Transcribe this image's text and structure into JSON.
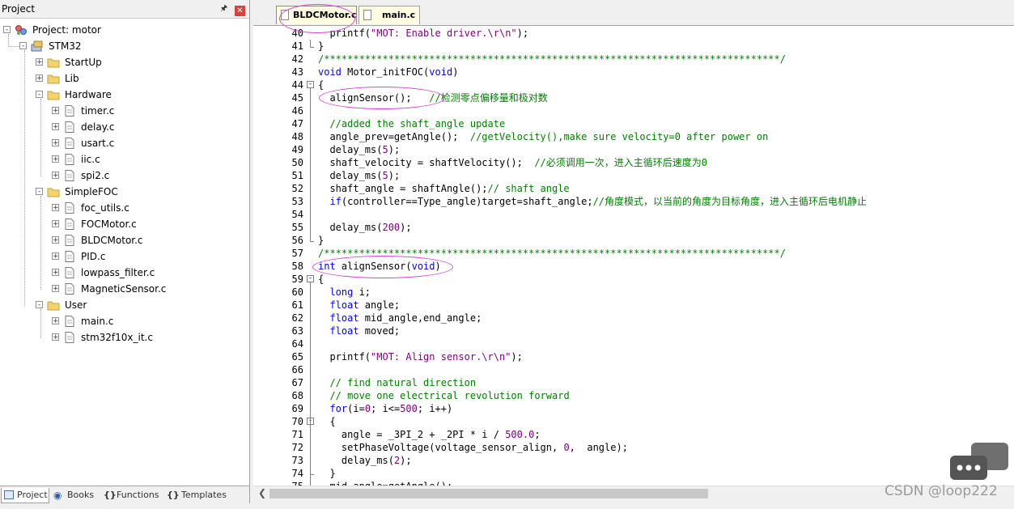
{
  "project_panel": {
    "title": "Project",
    "pin": "ㄧ",
    "close": "✕",
    "tree": [
      {
        "label": "Project: motor"
      },
      {
        "label": "STM32"
      },
      {
        "label": "StartUp"
      },
      {
        "label": "Lib"
      },
      {
        "label": "Hardware"
      },
      {
        "label": "timer.c"
      },
      {
        "label": "delay.c"
      },
      {
        "label": "usart.c"
      },
      {
        "label": "iic.c"
      },
      {
        "label": "spi2.c"
      },
      {
        "label": "SimpleFOC"
      },
      {
        "label": "foc_utils.c"
      },
      {
        "label": "FOCMotor.c"
      },
      {
        "label": "BLDCMotor.c"
      },
      {
        "label": "PID.c"
      },
      {
        "label": "lowpass_filter.c"
      },
      {
        "label": "MagneticSensor.c"
      },
      {
        "label": "User"
      },
      {
        "label": "main.c"
      },
      {
        "label": "stm32f10x_it.c"
      }
    ],
    "bottom_tabs": [
      "Project",
      "Books",
      "Functions",
      "Templates"
    ]
  },
  "editor": {
    "tabs": [
      "BLDCMotor.c",
      "main.c"
    ],
    "active_tab": "BLDCMotor.c",
    "lines": [
      {
        "n": "40",
        "code": "  printf(\"MOT: Enable driver.\\r\\n\");"
      },
      {
        "n": "41",
        "code": "}"
      },
      {
        "n": "42",
        "code": "/******************************************************************************/"
      },
      {
        "n": "43",
        "code": "void Motor_initFOC(void)"
      },
      {
        "n": "44",
        "code": "{"
      },
      {
        "n": "45",
        "code": "  alignSensor();   //检测零点偏移量和极对数"
      },
      {
        "n": "46",
        "code": ""
      },
      {
        "n": "47",
        "code": "  //added the shaft_angle update"
      },
      {
        "n": "48",
        "code": "  angle_prev=getAngle();  //getVelocity(),make sure velocity=0 after power on"
      },
      {
        "n": "49",
        "code": "  delay_ms(5);"
      },
      {
        "n": "50",
        "code": "  shaft_velocity = shaftVelocity();  //必须调用一次，进入主循环后速度为0"
      },
      {
        "n": "51",
        "code": "  delay_ms(5);"
      },
      {
        "n": "52",
        "code": "  shaft_angle = shaftAngle();// shaft angle"
      },
      {
        "n": "53",
        "code": "  if(controller==Type_angle)target=shaft_angle;//角度模式，以当前的角度为目标角度，进入主循环后电机静止"
      },
      {
        "n": "54",
        "code": ""
      },
      {
        "n": "55",
        "code": "  delay_ms(200);"
      },
      {
        "n": "56",
        "code": "}"
      },
      {
        "n": "57",
        "code": "/******************************************************************************/"
      },
      {
        "n": "58",
        "code": "int alignSensor(void)"
      },
      {
        "n": "59",
        "code": "{"
      },
      {
        "n": "60",
        "code": "  long i;"
      },
      {
        "n": "61",
        "code": "  float angle;"
      },
      {
        "n": "62",
        "code": "  float mid_angle,end_angle;"
      },
      {
        "n": "63",
        "code": "  float moved;"
      },
      {
        "n": "64",
        "code": ""
      },
      {
        "n": "65",
        "code": "  printf(\"MOT: Align sensor.\\r\\n\");"
      },
      {
        "n": "66",
        "code": ""
      },
      {
        "n": "67",
        "code": "  // find natural direction"
      },
      {
        "n": "68",
        "code": "  // move one electrical revolution forward"
      },
      {
        "n": "69",
        "code": "  for(i=0; i<=500; i++)"
      },
      {
        "n": "70",
        "code": "  {"
      },
      {
        "n": "71",
        "code": "    angle = _3PI_2 + _2PI * i / 500.0;"
      },
      {
        "n": "72",
        "code": "    setPhaseVoltage(voltage_sensor_align, 0,  angle);"
      },
      {
        "n": "73",
        "code": "    delay_ms(2);"
      },
      {
        "n": "74",
        "code": "  }"
      },
      {
        "n": "75",
        "code": "  mid_angle=getAngle();"
      }
    ]
  },
  "watermark": "CSDN @loop222"
}
